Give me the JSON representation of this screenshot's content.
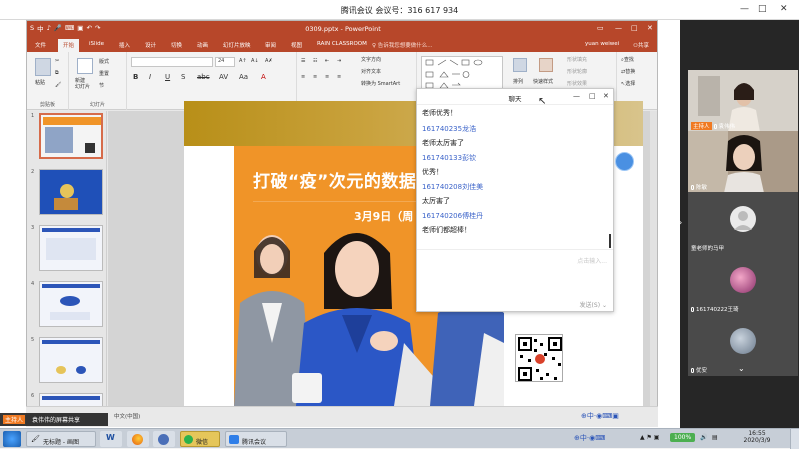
{
  "meeting": {
    "title": "腾讯会议 会议号：316 617 934"
  },
  "ppt": {
    "doc_title": "0309.pptx - PowerPoint",
    "quick_access": [
      "S",
      "中",
      "♪",
      "🎤",
      "⌨"
    ],
    "tabs": [
      "文件",
      "开始",
      "iSlide",
      "插入",
      "设计",
      "切换",
      "动画",
      "幻灯片放映",
      "审阅",
      "视图",
      "RAIN CLASSROOM"
    ],
    "active_tab": "开始",
    "search_placeholder": "告诉我您想要做什么...",
    "user_name": "yuan weiwei",
    "share_label": "共享",
    "ribbon": {
      "paste": "粘贴",
      "new_slide": "新建\n幻灯片",
      "layout": "版式",
      "reset": "重置",
      "section": "节",
      "clipboard": "剪贴板",
      "slides": "幻灯片",
      "font": "字体",
      "font_size": "24",
      "paragraph": "段落",
      "text_direction": "文字方向",
      "align_text": "对齐文本",
      "smartart": "转换为 SmartArt",
      "arrange": "排列",
      "quick_styles": "快速样式",
      "shape_fill": "形状填充",
      "shape_outline": "形状轮廓",
      "shape_effects": "形状效果",
      "find": "查找",
      "replace": "替换",
      "select": "选择",
      "drawing": "绘图",
      "editing": "编辑"
    },
    "slide_numbers": [
      "1",
      "2",
      "3",
      "4",
      "5",
      "6"
    ],
    "slide": {
      "headline": "打破“疫”次元的数据",
      "date": "3月9日（周"
    },
    "status_lang": "中文(中国)"
  },
  "chat": {
    "title": "聊天",
    "messages": [
      {
        "name": "",
        "text": "老师优秀！"
      },
      {
        "name": "161740235龙浩",
        "text": "老师太厉害了"
      },
      {
        "name": "161740133彭钦",
        "text": "优秀！"
      },
      {
        "name": "161740208刘佳美",
        "text": "太厉害了"
      },
      {
        "name": "161740206傅桂丹",
        "text": "老师们都超棒！"
      }
    ],
    "input_placeholder": "点击输入...",
    "send_label": "发送(S)"
  },
  "participants": [
    {
      "name": "袁伟伟",
      "host": true,
      "host_label": "主持人"
    },
    {
      "name": "陈敏",
      "host": false
    },
    {
      "name": "童老师的马甲",
      "host": false
    },
    {
      "name": "161740222王琦",
      "host": false
    },
    {
      "name": "优安",
      "host": false
    }
  ],
  "share_indicator": "袁伟伟的屏幕共享",
  "taskbar": {
    "apps": [
      "无标题 - 画图",
      "微信",
      "腾讯会议"
    ],
    "battery": "100%",
    "time": "16:55",
    "date": "2020/3/9"
  },
  "colors": {
    "ppt_accent": "#b7472a",
    "chat_name": "#3b63c9",
    "slide_orange": "#f09428",
    "host_badge": "#f07a22"
  }
}
